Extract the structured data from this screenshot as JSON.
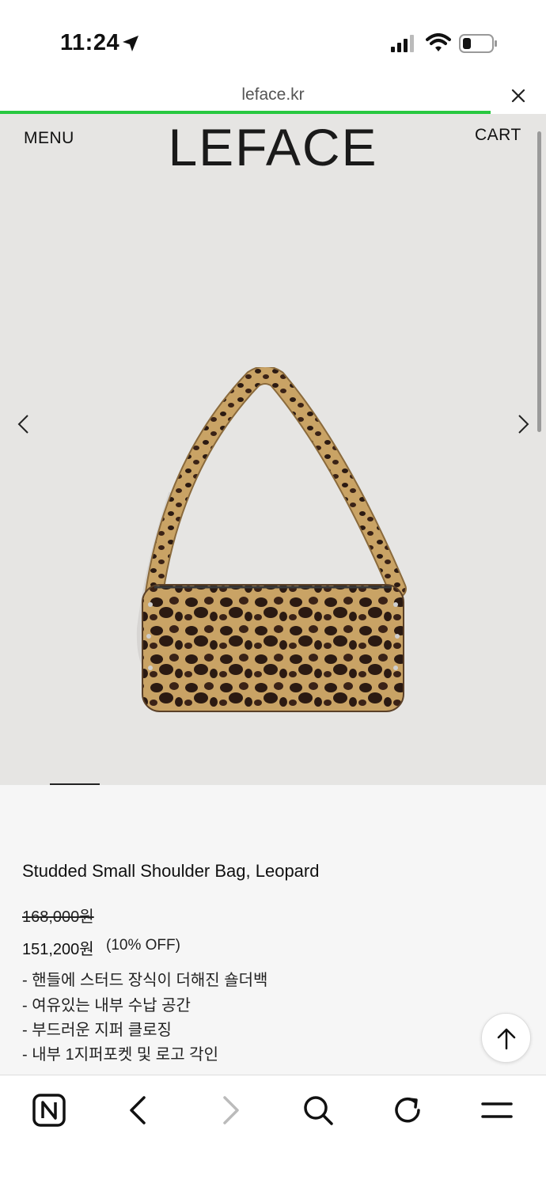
{
  "status": {
    "time": "11:24"
  },
  "browser": {
    "url": "leface.kr"
  },
  "header": {
    "menu_label": "MENU",
    "logo": "LEFACE",
    "cart_label": "CART"
  },
  "product": {
    "name": "Studded Small Shoulder Bag, Leopard",
    "original_price": "168,000원",
    "sale_price": "151,200원",
    "discount": "(10% OFF)",
    "description": [
      "- 핸들에 스터드 장식이 더해진 숄더백",
      "- 여유있는 내부 수납 공간",
      "- 부드러운 지퍼 클로징",
      "- 내부 1지퍼포켓 및 로고 각인"
    ]
  },
  "colors": {
    "progress": "#28c840",
    "hero_bg": "#e6e5e3"
  },
  "icons": [
    "location-arrow-icon",
    "signal-icon",
    "wifi-icon",
    "battery-icon",
    "close-icon",
    "chevron-left-icon",
    "chevron-right-icon",
    "arrow-up-icon",
    "naver-n-icon",
    "back-icon",
    "forward-icon",
    "search-icon",
    "reload-icon",
    "hamburger-menu-icon"
  ]
}
